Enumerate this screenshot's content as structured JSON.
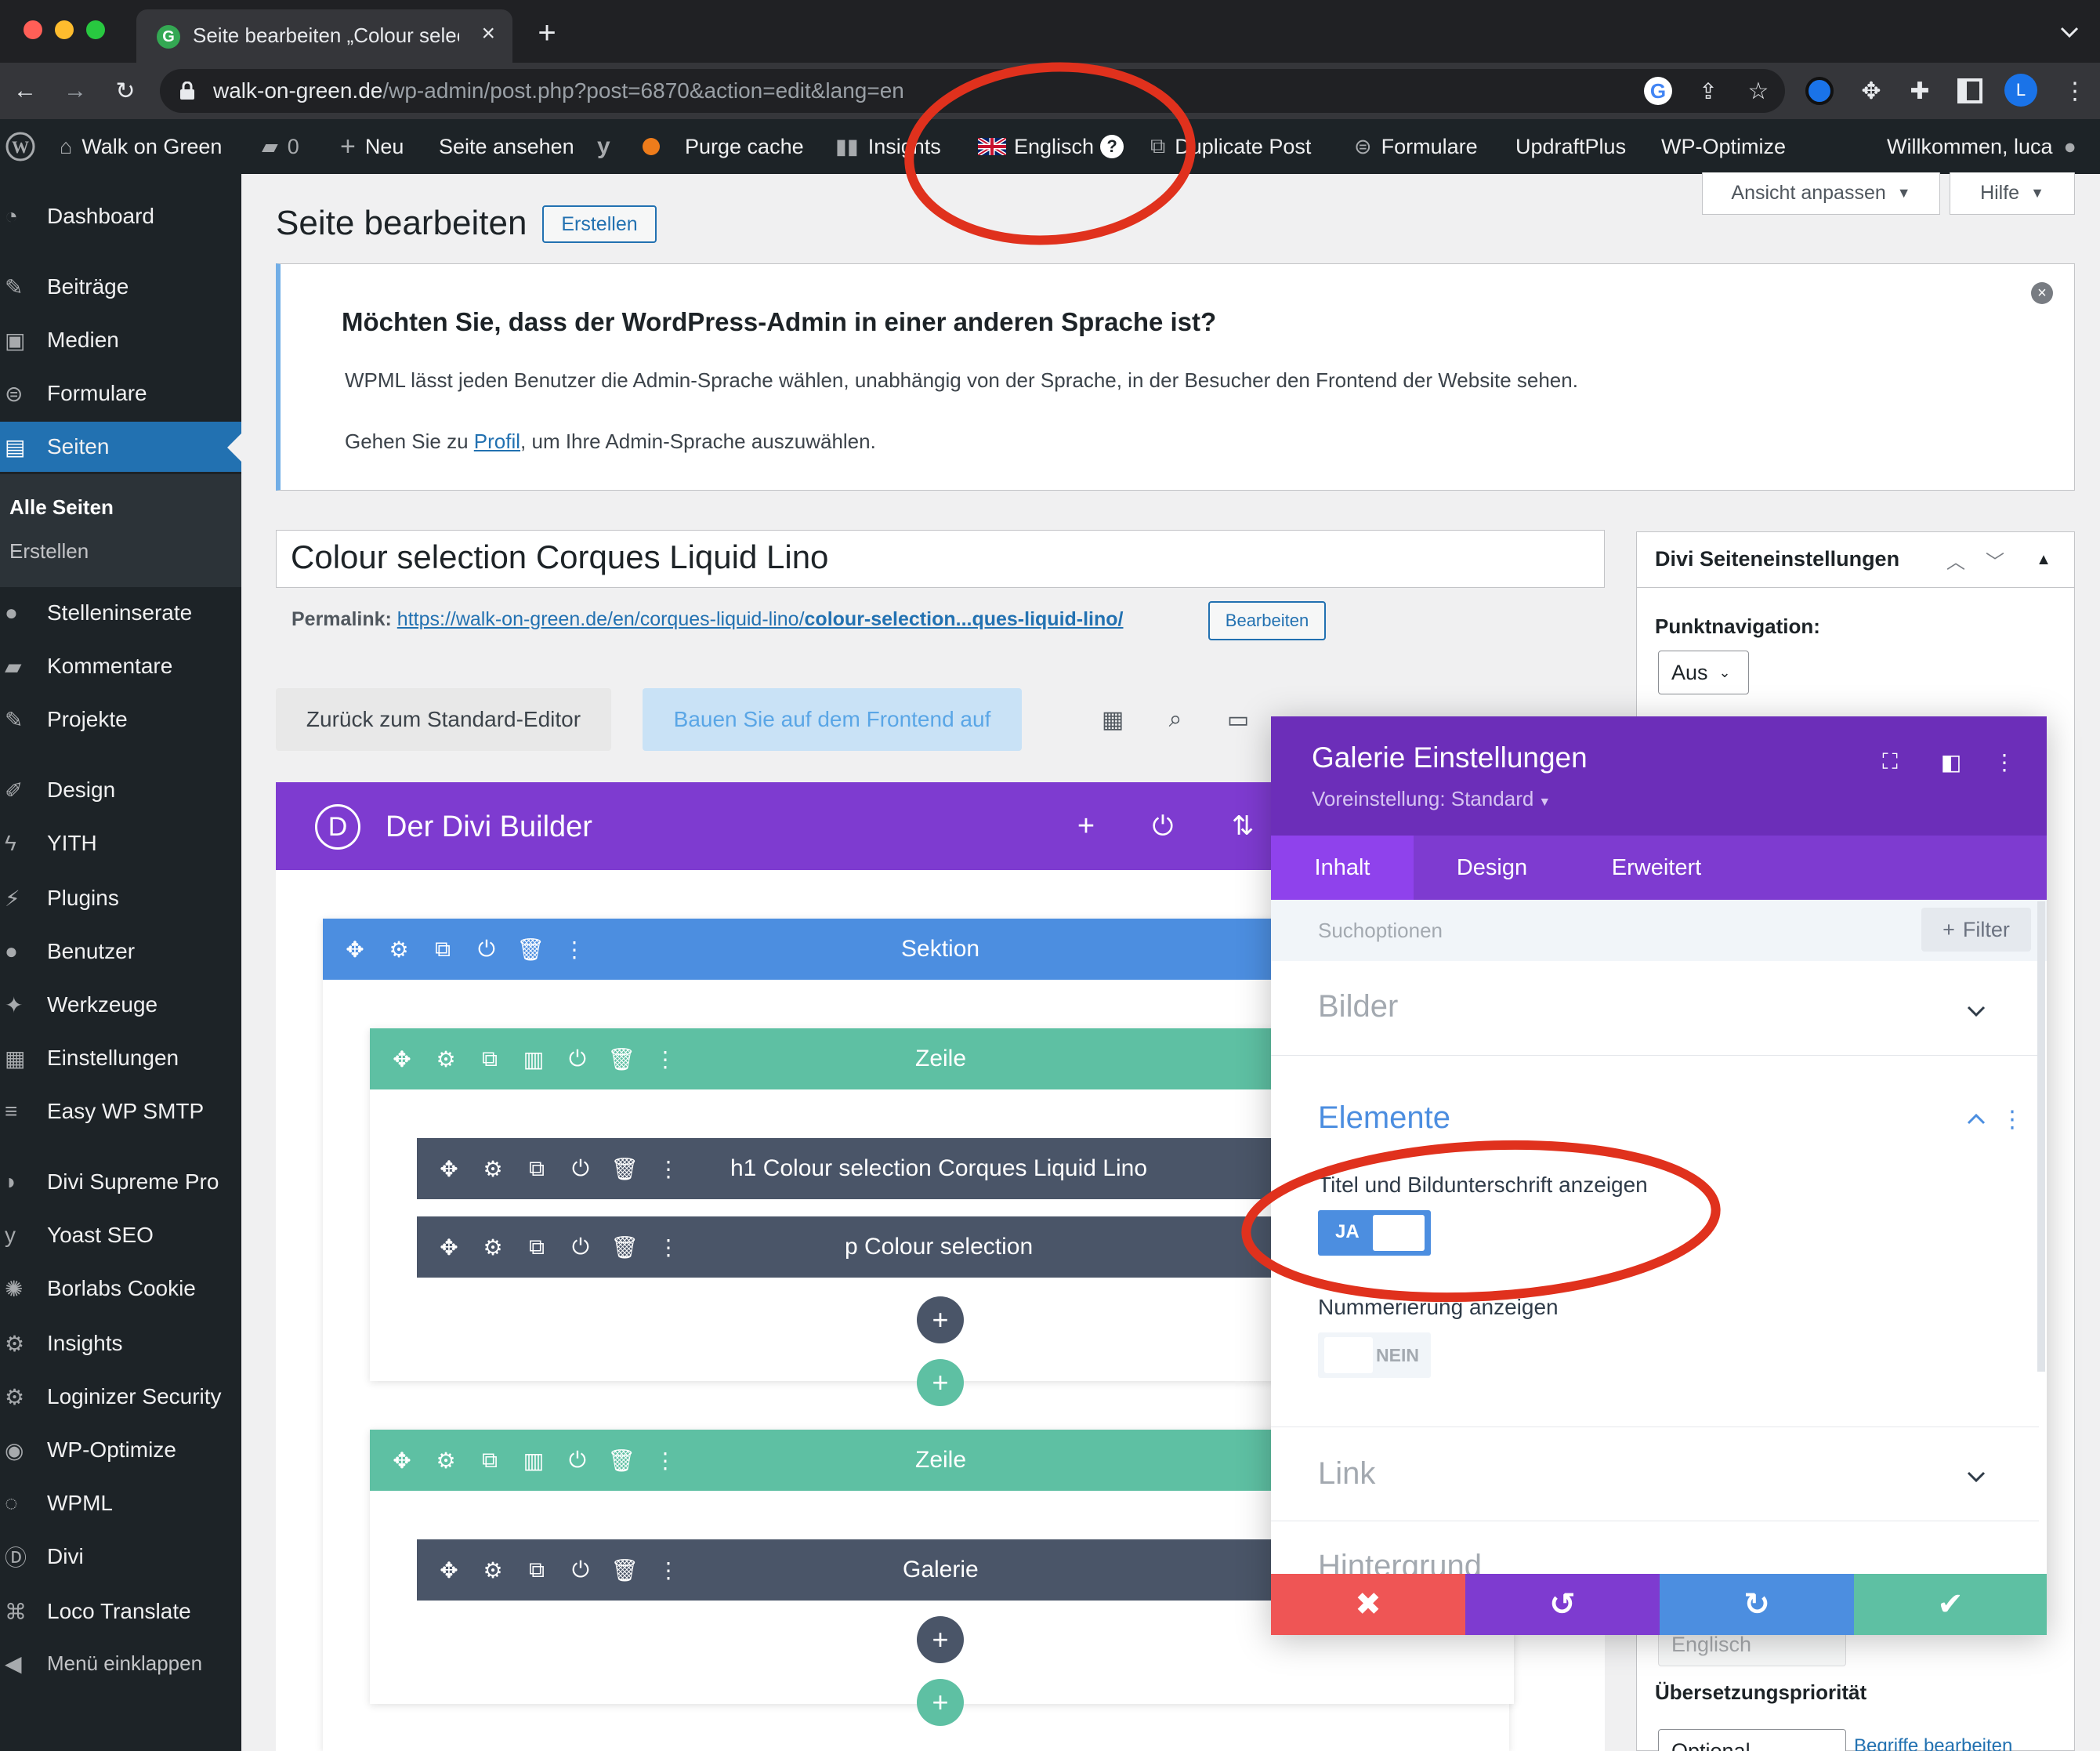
{
  "browser": {
    "tab_title": "Seite bearbeiten „Colour selecti",
    "tab_favicon": "G",
    "url_host": "walk-on-green.de",
    "url_path": "/wp-admin/post.php?post=6870&action=edit&lang=en",
    "profile_initial": "L"
  },
  "adminbar": {
    "site_name": "Walk on Green",
    "comments_count": "0",
    "new_label": "Neu",
    "view_page": "Seite ansehen",
    "purge_cache": "Purge cache",
    "insights": "Insights",
    "language": "Englisch",
    "duplicate": "Duplicate Post",
    "forms": "Formulare",
    "updraft": "UpdraftPlus",
    "wpoptimize": "WP-Optimize",
    "welcome": "Willkommen, luca"
  },
  "sidebar": {
    "items": [
      {
        "label": "Dashboard",
        "icon": "dashboard-icon"
      },
      {
        "label": "Beiträge",
        "icon": "pin-icon"
      },
      {
        "label": "Medien",
        "icon": "media-icon"
      },
      {
        "label": "Formulare",
        "icon": "forms-icon"
      },
      {
        "label": "Seiten",
        "icon": "pages-icon"
      },
      {
        "label": "Stelleninserate",
        "icon": "user-icon"
      },
      {
        "label": "Kommentare",
        "icon": "comment-icon"
      },
      {
        "label": "Projekte",
        "icon": "pin-icon"
      },
      {
        "label": "Design",
        "icon": "brush-icon"
      },
      {
        "label": "YITH",
        "icon": "yith-icon"
      },
      {
        "label": "Plugins",
        "icon": "plugin-icon"
      },
      {
        "label": "Benutzer",
        "icon": "user-icon"
      },
      {
        "label": "Werkzeuge",
        "icon": "wrench-icon"
      },
      {
        "label": "Einstellungen",
        "icon": "settings-icon"
      },
      {
        "label": "Easy WP SMTP",
        "icon": "mail-icon"
      },
      {
        "label": "Divi Supreme Pro",
        "icon": "divi-supreme-icon"
      },
      {
        "label": "Yoast SEO",
        "icon": "yoast-icon"
      },
      {
        "label": "Borlabs Cookie",
        "icon": "cookie-icon"
      },
      {
        "label": "Insights",
        "icon": "insights-icon"
      },
      {
        "label": "Loginizer Security",
        "icon": "gear-icon"
      },
      {
        "label": "WP-Optimize",
        "icon": "optimize-icon"
      },
      {
        "label": "WPML",
        "icon": "wpml-icon"
      },
      {
        "label": "Divi",
        "icon": "divi-icon"
      },
      {
        "label": "Loco Translate",
        "icon": "translate-icon"
      },
      {
        "label": "Menü einklappen",
        "icon": "collapse-icon"
      }
    ],
    "submenu": [
      "Alle Seiten",
      "Erstellen"
    ]
  },
  "main": {
    "title": "Seite bearbeiten",
    "create_button": "Erstellen",
    "screen_options": "Ansicht anpassen",
    "help": "Hilfe",
    "notice": {
      "heading": "Möchten Sie, dass der WordPress-Admin in einer anderen Sprache ist?",
      "line1": "WPML lässt jeden Benutzer die Admin-Sprache wählen, unabhängig von der Sprache, in der Besucher den Frontend der Website sehen.",
      "line2_pre": "Gehen Sie zu ",
      "line2_link": "Profil",
      "line2_post": ", um Ihre Admin-Sprache auszuwählen."
    },
    "post_title": "Colour selection Corques Liquid Lino",
    "permalink_label": "Permalink:",
    "permalink_url": "https://walk-on-green.de/en/corques-liquid-lino/",
    "permalink_slug": "colour-selection...ques-liquid-lino/",
    "permalink_edit": "Bearbeiten",
    "back_button": "Zurück zum Standard-Editor",
    "frontend_button": "Bauen Sie auf dem Frontend auf"
  },
  "divi": {
    "builder_title": "Der Divi Builder",
    "section": "Sektion",
    "row1": "Zeile",
    "module_h1": "h1 Colour selection Corques Liquid Lino",
    "module_p": "p Colour selection",
    "row2": "Zeile",
    "module_gallery": "Galerie"
  },
  "side_panel": {
    "title": "Divi Seiteneinstellungen",
    "dot_nav_label": "Punktnavigation:",
    "dot_nav_value": "Aus",
    "language_value": "Englisch",
    "priority_label": "Übersetzungspriorität",
    "priority_value": "Optional",
    "edit_terms": "Begriffe bearbeiten"
  },
  "modal": {
    "title": "Galerie Einstellungen",
    "preset": "Voreinstellung: Standard",
    "tabs": [
      "Inhalt",
      "Design",
      "Erweitert"
    ],
    "search_placeholder": "Suchoptionen",
    "filter": "Filter",
    "group_images": "Bilder",
    "group_elements": "Elemente",
    "toggle1_label": "Titel und Bildunterschrift anzeigen",
    "toggle1_state": "JA",
    "toggle2_label": "Nummerierung anzeigen",
    "toggle2_state": "NEIN",
    "group_link": "Link",
    "group_background": "Hintergrund"
  },
  "colors": {
    "divi_purple": "#7e3bd0",
    "divi_modal_purple": "#6c2eb9",
    "section_blue": "#4c8ee0",
    "row_teal": "#5ec0a3",
    "module_dark": "#4a5568",
    "wp_blue": "#2271b1",
    "annotation_red": "#e0311d"
  }
}
